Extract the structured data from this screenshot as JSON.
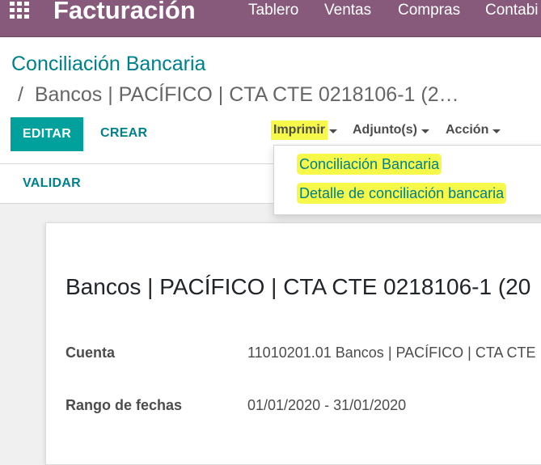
{
  "topbar": {
    "app_title": "Facturación",
    "menu": [
      "Tablero",
      "Ventas",
      "Compras",
      "Contabi"
    ],
    "colors": {
      "bar": "#875a7b",
      "accent": "#00a09d",
      "link": "#00808a",
      "highlight": "#f6f84a"
    },
    "apps_icon": "grid-icon"
  },
  "breadcrumb": {
    "root": "Conciliación Bancaria",
    "separator": "/",
    "current": "Bancos | PACÍFICO | CTA CTE 0218106-1 (2…"
  },
  "buttons": {
    "edit": "EDITAR",
    "create": "CREAR",
    "validate": "VALIDAR"
  },
  "dropdown_toggles": {
    "print": "Imprimir",
    "attachments": "Adjunto(s)",
    "action": "Acción"
  },
  "print_menu": {
    "items": [
      "Conciliación Bancaria",
      "Detalle de conciliación bancaria"
    ]
  },
  "sheet": {
    "title": "Bancos | PACÍFICO | CTA CTE 0218106-1 (20",
    "fields": [
      {
        "label": "Cuenta",
        "value": "11010201.01 Bancos | PACÍFICO | CTA CTE"
      },
      {
        "label": "Rango de fechas",
        "value": "01/01/2020 - 31/01/2020"
      }
    ]
  }
}
